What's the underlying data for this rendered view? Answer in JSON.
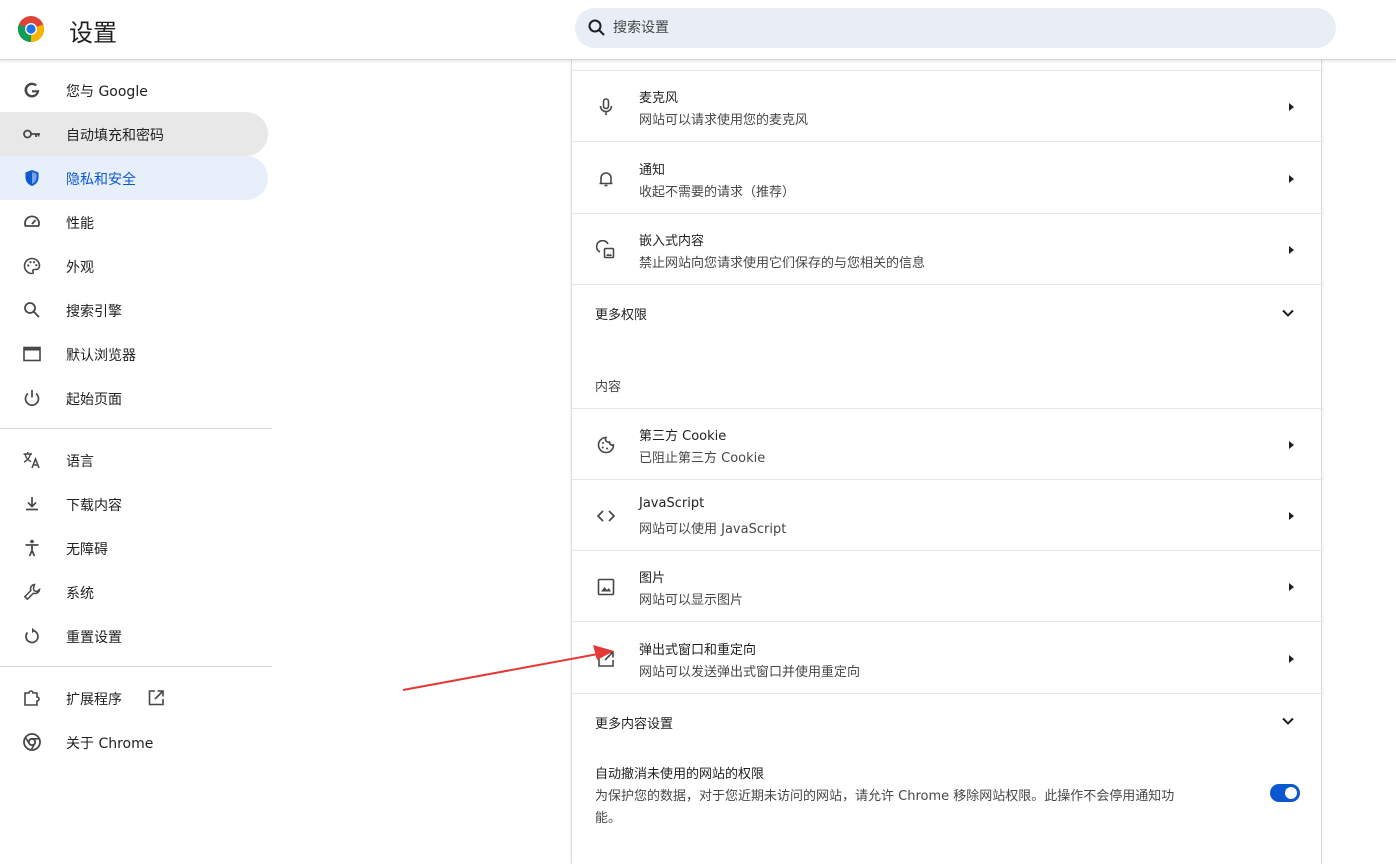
{
  "header": {
    "title": "设置",
    "search_placeholder": "搜索设置"
  },
  "sidebar": {
    "items": [
      {
        "label": "您与 Google",
        "icon": "google-g-icon"
      },
      {
        "label": "自动填充和密码",
        "icon": "key-icon"
      },
      {
        "label": "隐私和安全",
        "icon": "shield-icon"
      },
      {
        "label": "性能",
        "icon": "gauge-icon"
      },
      {
        "label": "外观",
        "icon": "palette-icon"
      },
      {
        "label": "搜索引擎",
        "icon": "search-icon"
      },
      {
        "label": "默认浏览器",
        "icon": "browser-window-icon"
      },
      {
        "label": "起始页面",
        "icon": "power-icon"
      },
      {
        "label": "语言",
        "icon": "translate-icon"
      },
      {
        "label": "下载内容",
        "icon": "download-icon"
      },
      {
        "label": "无障碍",
        "icon": "accessibility-icon"
      },
      {
        "label": "系统",
        "icon": "wrench-icon"
      },
      {
        "label": "重置设置",
        "icon": "reset-icon"
      },
      {
        "label": "扩展程序",
        "icon": "puzzle-icon"
      },
      {
        "label": "关于 Chrome",
        "icon": "chrome-icon"
      }
    ],
    "active_item": "隐私和安全",
    "highlighted_item": "自动填充和密码"
  },
  "main": {
    "permissions": [
      {
        "title": "麦克风",
        "subtitle": "网站可以请求使用您的麦克风",
        "icon": "microphone-icon"
      },
      {
        "title": "通知",
        "subtitle": "收起不需要的请求（推荐）",
        "icon": "bell-icon"
      },
      {
        "title": "嵌入式内容",
        "subtitle": "禁止网站向您请求使用它们保存的与您相关的信息",
        "icon": "embedded-content-icon"
      }
    ],
    "more_permissions_label": "更多权限",
    "content_heading": "内容",
    "content": [
      {
        "title": "第三方 Cookie",
        "subtitle": "已阻止第三方 Cookie",
        "icon": "cookie-icon"
      },
      {
        "title": "JavaScript",
        "subtitle": "网站可以使用 JavaScript",
        "icon": "code-icon"
      },
      {
        "title": "图片",
        "subtitle": "网站可以显示图片",
        "icon": "image-icon"
      },
      {
        "title": "弹出式窗口和重定向",
        "subtitle": "网站可以发送弹出式窗口并使用重定向",
        "icon": "popup-icon"
      }
    ],
    "more_content_label": "更多内容设置",
    "auto_revoke": {
      "title": "自动撤消未使用的网站的权限",
      "description_line1": "为保护您的数据，对于您近期未访问的网站，请允许 Chrome 移除网站权限。此操作不会停用通知功",
      "description_line2": "能。",
      "enabled": true
    }
  },
  "colors": {
    "accent": "#0b57d0",
    "active_nav_bg": "#e7effb",
    "annotation_arrow": "#e53935"
  }
}
